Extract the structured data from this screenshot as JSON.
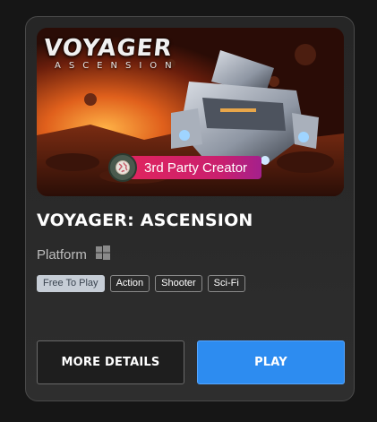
{
  "card": {
    "hero": {
      "logo_title": "VOYAGER",
      "logo_subtitle": "ASCENSION",
      "badge_label": "3rd Party Creator",
      "badge_icon": "globe-icon"
    },
    "title": "VOYAGER: ASCENSION",
    "platform_label": "Platform",
    "platform_icon": "windows-icon",
    "tags": [
      "Free To Play",
      "Action",
      "Shooter",
      "Sci-Fi"
    ],
    "buttons": {
      "details_label": "MORE DETAILS",
      "play_label": "PLAY"
    }
  },
  "colors": {
    "play_button": "#2d8cf0",
    "badge_start": "#e0245e",
    "badge_end": "#a4208c",
    "price_tag_bg": "#c6cdd6"
  }
}
